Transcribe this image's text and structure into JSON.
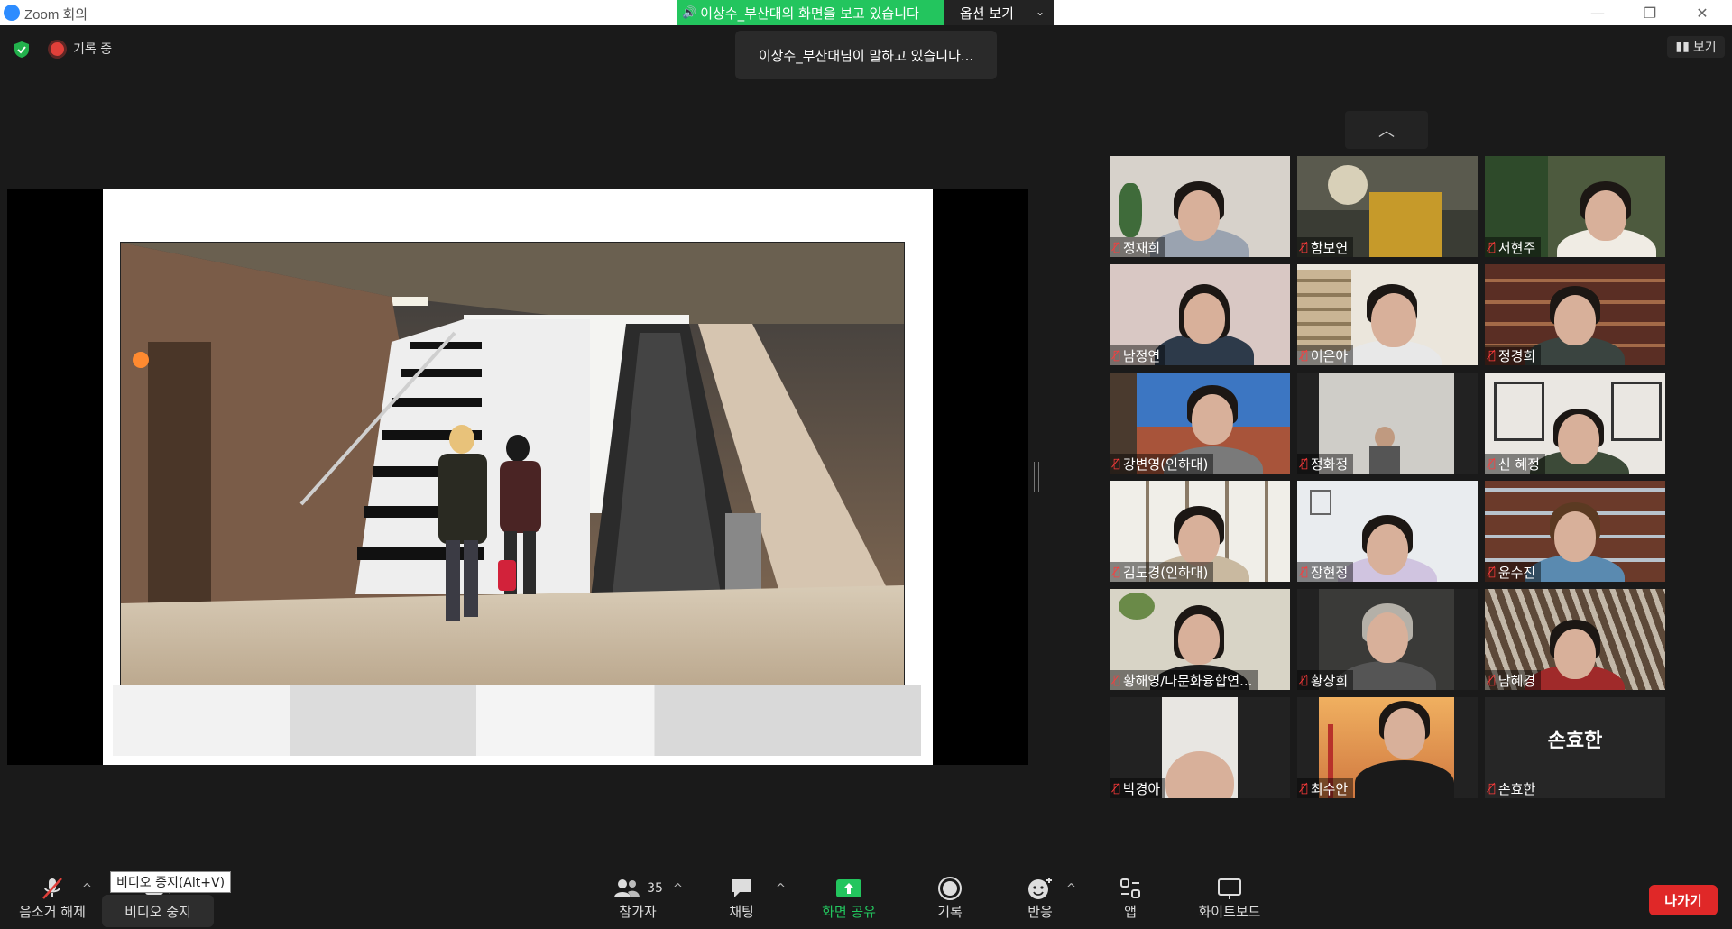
{
  "window": {
    "title": "Zoom 회의"
  },
  "share_banner": {
    "text": "이상수_부산대의 화면을 보고 있습니다",
    "options_label": "옵션 보기"
  },
  "top_bar": {
    "recording_label": "기록 중",
    "speaking_text": "이상수_부산대님이 말하고 있습니다...",
    "view_label": "보기"
  },
  "participants": [
    {
      "name": "정재희"
    },
    {
      "name": "함보연"
    },
    {
      "name": "서현주"
    },
    {
      "name": "남정연"
    },
    {
      "name": "이은아"
    },
    {
      "name": "정경희"
    },
    {
      "name": "강변영(인하대)"
    },
    {
      "name": "정화정"
    },
    {
      "name": "신 혜정"
    },
    {
      "name": "김도경(인하대)"
    },
    {
      "name": "장현정"
    },
    {
      "name": "윤수진"
    },
    {
      "name": "황해영/다문화융합연..."
    },
    {
      "name": "황상희"
    },
    {
      "name": "남혜경"
    },
    {
      "name": "박경아"
    },
    {
      "name": "최수안"
    },
    {
      "name": "손효한",
      "avatar_text": "손효한"
    }
  ],
  "toolbar": {
    "unmute": "음소거 해제",
    "video_tooltip": "비디오 중지(Alt+V)",
    "video": "비디오 중지",
    "participants": "참가자",
    "participants_count": "35",
    "chat": "채팅",
    "share": "화면 공유",
    "record": "기록",
    "reactions": "반응",
    "apps": "앱",
    "whiteboard": "화이트보드",
    "leave": "나가기"
  },
  "colors": {
    "share_green": "#23c55e",
    "leave_red": "#e02828",
    "mute_red": "#ff3b3b",
    "record_red": "#e0403a"
  }
}
